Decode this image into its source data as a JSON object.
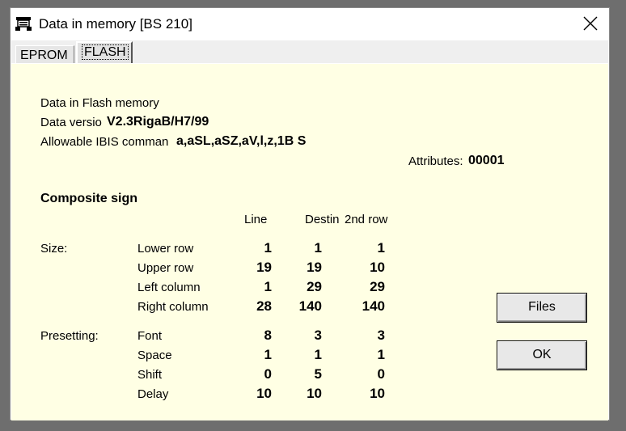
{
  "window": {
    "title": "Data in memory [BS 210]"
  },
  "tabs": [
    {
      "label": "EPROM"
    },
    {
      "label": "FLASH"
    }
  ],
  "info": {
    "heading": "Data in Flash memory",
    "version_label": "Data versio",
    "version_value": "V2.3RigaB/H7/99",
    "commands_label": "Allowable IBIS comman",
    "commands_value": "a,aSL,aSZ,aV,l,z,1B S",
    "attributes_label": "Attributes:",
    "attributes_value": "00001"
  },
  "composite": {
    "title": "Composite sign",
    "columns": [
      "Line",
      "Destin",
      "2nd row"
    ],
    "groups": [
      {
        "label": "Size:",
        "rows": [
          {
            "label": "Lower row",
            "values": [
              "1",
              "1",
              "1"
            ]
          },
          {
            "label": "Upper row",
            "values": [
              "19",
              "19",
              "10"
            ]
          },
          {
            "label": "Left column",
            "values": [
              "1",
              "29",
              "29"
            ]
          },
          {
            "label": "Right column",
            "values": [
              "28",
              "140",
              "140"
            ]
          }
        ]
      },
      {
        "label": "Presetting:",
        "rows": [
          {
            "label": "Font",
            "values": [
              "8",
              "3",
              "3"
            ]
          },
          {
            "label": "Space",
            "values": [
              "1",
              "1",
              "1"
            ]
          },
          {
            "label": "Shift",
            "values": [
              "0",
              "5",
              "0"
            ]
          },
          {
            "label": "Delay",
            "values": [
              "10",
              "10",
              "10"
            ]
          }
        ]
      }
    ]
  },
  "buttons": {
    "files": "Files",
    "ok": "OK"
  }
}
